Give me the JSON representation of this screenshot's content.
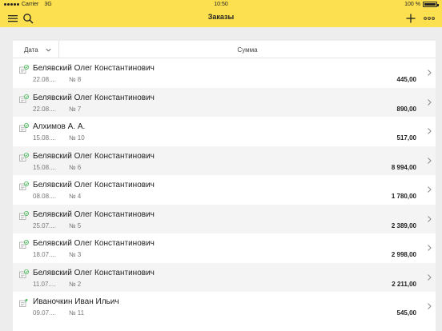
{
  "status": {
    "carrier": "Carrier",
    "network": "3G",
    "time": "10:50",
    "battery": "100 %"
  },
  "nav": {
    "title": "Заказы"
  },
  "table": {
    "col_date": "Дата",
    "col_sum": "Сумма"
  },
  "colors": {
    "accent": "#fce04f",
    "check": "#3fb34f"
  },
  "orders": [
    {
      "name": "Белявский Олег Константинович",
      "date": "22.08....",
      "number": "№ 8",
      "amount": "445,00",
      "status_icon": "doc-check-icon"
    },
    {
      "name": "Белявский Олег Константинович",
      "date": "22.08....",
      "number": "№ 7",
      "amount": "890,00",
      "status_icon": "doc-check-icon"
    },
    {
      "name": "Алхимов А. А.",
      "date": "15.08....",
      "number": "№ 10",
      "amount": "517,00",
      "status_icon": "doc-check-icon"
    },
    {
      "name": "Белявский Олег Константинович",
      "date": "15.08....",
      "number": "№ 6",
      "amount": "8 994,00",
      "status_icon": "doc-check-icon"
    },
    {
      "name": "Белявский Олег Константинович",
      "date": "08.08....",
      "number": "№ 4",
      "amount": "1 780,00",
      "status_icon": "doc-check-icon"
    },
    {
      "name": "Белявский Олег Константинович",
      "date": "25.07....",
      "number": "№ 5",
      "amount": "2 389,00",
      "status_icon": "doc-check-icon"
    },
    {
      "name": "Белявский Олег Константинович",
      "date": "18.07....",
      "number": "№ 3",
      "amount": "2 998,00",
      "status_icon": "doc-check-icon"
    },
    {
      "name": "Белявский Олег Константинович",
      "date": "11.07....",
      "number": "№ 2",
      "amount": "2 211,00",
      "status_icon": "doc-check-icon"
    },
    {
      "name": "Иваночкин Иван Ильич",
      "date": "09.07....",
      "number": "№ 11",
      "amount": "545,00",
      "status_icon": "doc-flag-icon"
    }
  ]
}
